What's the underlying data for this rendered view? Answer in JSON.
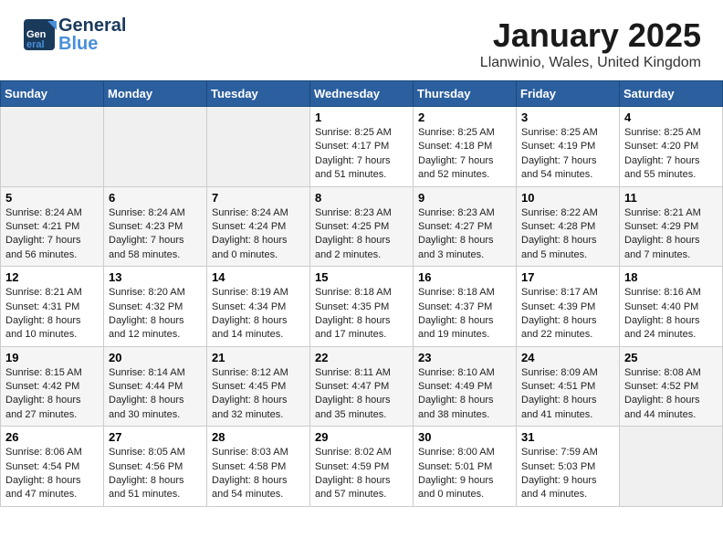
{
  "header": {
    "logo_line1": "General",
    "logo_line2": "Blue",
    "title": "January 2025",
    "subtitle": "Llanwinio, Wales, United Kingdom"
  },
  "weekdays": [
    "Sunday",
    "Monday",
    "Tuesday",
    "Wednesday",
    "Thursday",
    "Friday",
    "Saturday"
  ],
  "weeks": [
    [
      {
        "day": "",
        "sunrise": "",
        "sunset": "",
        "daylight": ""
      },
      {
        "day": "",
        "sunrise": "",
        "sunset": "",
        "daylight": ""
      },
      {
        "day": "",
        "sunrise": "",
        "sunset": "",
        "daylight": ""
      },
      {
        "day": "1",
        "sunrise": "Sunrise: 8:25 AM",
        "sunset": "Sunset: 4:17 PM",
        "daylight": "Daylight: 7 hours and 51 minutes."
      },
      {
        "day": "2",
        "sunrise": "Sunrise: 8:25 AM",
        "sunset": "Sunset: 4:18 PM",
        "daylight": "Daylight: 7 hours and 52 minutes."
      },
      {
        "day": "3",
        "sunrise": "Sunrise: 8:25 AM",
        "sunset": "Sunset: 4:19 PM",
        "daylight": "Daylight: 7 hours and 54 minutes."
      },
      {
        "day": "4",
        "sunrise": "Sunrise: 8:25 AM",
        "sunset": "Sunset: 4:20 PM",
        "daylight": "Daylight: 7 hours and 55 minutes."
      }
    ],
    [
      {
        "day": "5",
        "sunrise": "Sunrise: 8:24 AM",
        "sunset": "Sunset: 4:21 PM",
        "daylight": "Daylight: 7 hours and 56 minutes."
      },
      {
        "day": "6",
        "sunrise": "Sunrise: 8:24 AM",
        "sunset": "Sunset: 4:23 PM",
        "daylight": "Daylight: 7 hours and 58 minutes."
      },
      {
        "day": "7",
        "sunrise": "Sunrise: 8:24 AM",
        "sunset": "Sunset: 4:24 PM",
        "daylight": "Daylight: 8 hours and 0 minutes."
      },
      {
        "day": "8",
        "sunrise": "Sunrise: 8:23 AM",
        "sunset": "Sunset: 4:25 PM",
        "daylight": "Daylight: 8 hours and 2 minutes."
      },
      {
        "day": "9",
        "sunrise": "Sunrise: 8:23 AM",
        "sunset": "Sunset: 4:27 PM",
        "daylight": "Daylight: 8 hours and 3 minutes."
      },
      {
        "day": "10",
        "sunrise": "Sunrise: 8:22 AM",
        "sunset": "Sunset: 4:28 PM",
        "daylight": "Daylight: 8 hours and 5 minutes."
      },
      {
        "day": "11",
        "sunrise": "Sunrise: 8:21 AM",
        "sunset": "Sunset: 4:29 PM",
        "daylight": "Daylight: 8 hours and 7 minutes."
      }
    ],
    [
      {
        "day": "12",
        "sunrise": "Sunrise: 8:21 AM",
        "sunset": "Sunset: 4:31 PM",
        "daylight": "Daylight: 8 hours and 10 minutes."
      },
      {
        "day": "13",
        "sunrise": "Sunrise: 8:20 AM",
        "sunset": "Sunset: 4:32 PM",
        "daylight": "Daylight: 8 hours and 12 minutes."
      },
      {
        "day": "14",
        "sunrise": "Sunrise: 8:19 AM",
        "sunset": "Sunset: 4:34 PM",
        "daylight": "Daylight: 8 hours and 14 minutes."
      },
      {
        "day": "15",
        "sunrise": "Sunrise: 8:18 AM",
        "sunset": "Sunset: 4:35 PM",
        "daylight": "Daylight: 8 hours and 17 minutes."
      },
      {
        "day": "16",
        "sunrise": "Sunrise: 8:18 AM",
        "sunset": "Sunset: 4:37 PM",
        "daylight": "Daylight: 8 hours and 19 minutes."
      },
      {
        "day": "17",
        "sunrise": "Sunrise: 8:17 AM",
        "sunset": "Sunset: 4:39 PM",
        "daylight": "Daylight: 8 hours and 22 minutes."
      },
      {
        "day": "18",
        "sunrise": "Sunrise: 8:16 AM",
        "sunset": "Sunset: 4:40 PM",
        "daylight": "Daylight: 8 hours and 24 minutes."
      }
    ],
    [
      {
        "day": "19",
        "sunrise": "Sunrise: 8:15 AM",
        "sunset": "Sunset: 4:42 PM",
        "daylight": "Daylight: 8 hours and 27 minutes."
      },
      {
        "day": "20",
        "sunrise": "Sunrise: 8:14 AM",
        "sunset": "Sunset: 4:44 PM",
        "daylight": "Daylight: 8 hours and 30 minutes."
      },
      {
        "day": "21",
        "sunrise": "Sunrise: 8:12 AM",
        "sunset": "Sunset: 4:45 PM",
        "daylight": "Daylight: 8 hours and 32 minutes."
      },
      {
        "day": "22",
        "sunrise": "Sunrise: 8:11 AM",
        "sunset": "Sunset: 4:47 PM",
        "daylight": "Daylight: 8 hours and 35 minutes."
      },
      {
        "day": "23",
        "sunrise": "Sunrise: 8:10 AM",
        "sunset": "Sunset: 4:49 PM",
        "daylight": "Daylight: 8 hours and 38 minutes."
      },
      {
        "day": "24",
        "sunrise": "Sunrise: 8:09 AM",
        "sunset": "Sunset: 4:51 PM",
        "daylight": "Daylight: 8 hours and 41 minutes."
      },
      {
        "day": "25",
        "sunrise": "Sunrise: 8:08 AM",
        "sunset": "Sunset: 4:52 PM",
        "daylight": "Daylight: 8 hours and 44 minutes."
      }
    ],
    [
      {
        "day": "26",
        "sunrise": "Sunrise: 8:06 AM",
        "sunset": "Sunset: 4:54 PM",
        "daylight": "Daylight: 8 hours and 47 minutes."
      },
      {
        "day": "27",
        "sunrise": "Sunrise: 8:05 AM",
        "sunset": "Sunset: 4:56 PM",
        "daylight": "Daylight: 8 hours and 51 minutes."
      },
      {
        "day": "28",
        "sunrise": "Sunrise: 8:03 AM",
        "sunset": "Sunset: 4:58 PM",
        "daylight": "Daylight: 8 hours and 54 minutes."
      },
      {
        "day": "29",
        "sunrise": "Sunrise: 8:02 AM",
        "sunset": "Sunset: 4:59 PM",
        "daylight": "Daylight: 8 hours and 57 minutes."
      },
      {
        "day": "30",
        "sunrise": "Sunrise: 8:00 AM",
        "sunset": "Sunset: 5:01 PM",
        "daylight": "Daylight: 9 hours and 0 minutes."
      },
      {
        "day": "31",
        "sunrise": "Sunrise: 7:59 AM",
        "sunset": "Sunset: 5:03 PM",
        "daylight": "Daylight: 9 hours and 4 minutes."
      },
      {
        "day": "",
        "sunrise": "",
        "sunset": "",
        "daylight": ""
      }
    ]
  ]
}
